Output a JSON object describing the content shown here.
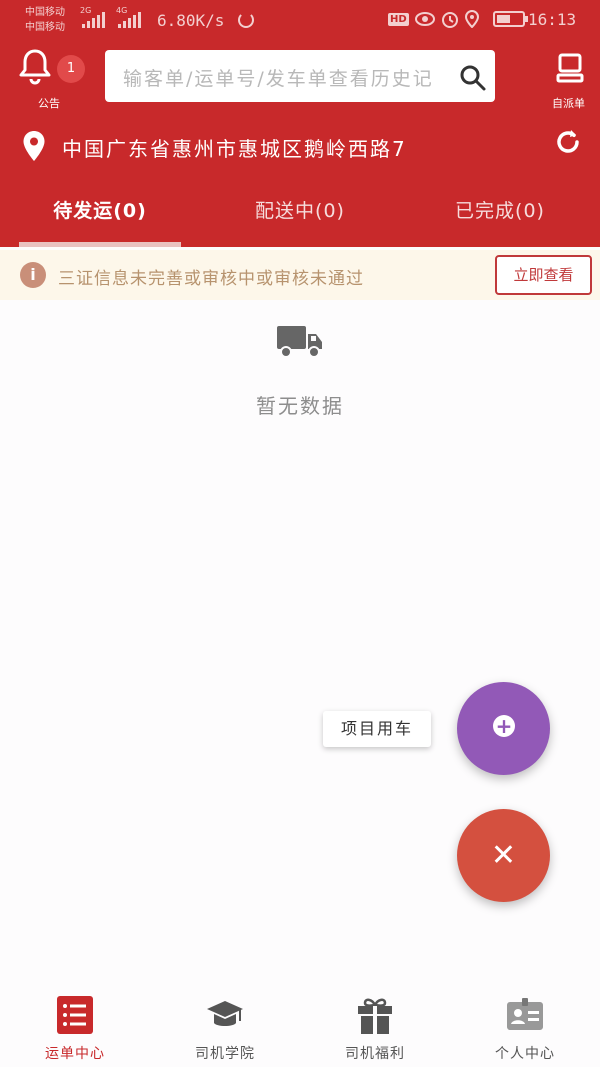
{
  "status_bar": {
    "carrier_1": "中国移动",
    "carrier_2": "中国移动",
    "net_1": "2G",
    "net_2": "4G",
    "speed": "6.80K/s",
    "hd": "HD",
    "time": "16:13",
    "battery_level": 0.55
  },
  "header": {
    "notice_label": "公告",
    "notice_badge": "1",
    "search": {
      "placeholder": "输客单/运单号/发车单查看历史记"
    },
    "dispatch_label": "自派单",
    "address": "中国广东省惠州市惠城区鹅岭西路7"
  },
  "tabs": [
    {
      "label": "待发运(0)",
      "active": true
    },
    {
      "label": "配送中(0)",
      "active": false
    },
    {
      "label": "已完成(0)",
      "active": false
    }
  ],
  "notice_bar": {
    "icon": "info-icon",
    "text": "三证信息未完善或审核中或审核未通过",
    "button": "立即查看"
  },
  "empty_state": {
    "icon": "truck-icon",
    "text": "暂无数据"
  },
  "fab": {
    "menu_label": "项目用车",
    "add_icon": "plus-icon",
    "close_icon": "close-icon"
  },
  "bottom_nav": [
    {
      "label": "运单中心",
      "icon": "list-icon",
      "active": true
    },
    {
      "label": "司机学院",
      "icon": "graduation-cap-icon",
      "active": false
    },
    {
      "label": "司机福利",
      "icon": "gift-icon",
      "active": false
    },
    {
      "label": "个人中心",
      "icon": "id-card-icon",
      "active": false
    }
  ],
  "colors": {
    "brand_red": "#c8292b",
    "fab_purple": "#9259b7",
    "fab_red": "#d4503f",
    "notice_bg": "#fdf7ea"
  }
}
